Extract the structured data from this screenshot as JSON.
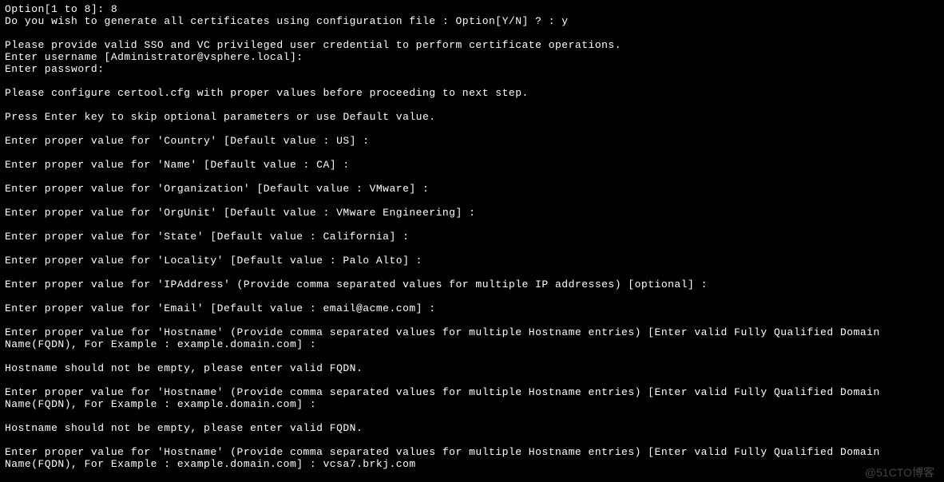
{
  "terminal": {
    "lines": [
      "Option[1 to 8]: 8",
      "Do you wish to generate all certificates using configuration file : Option[Y/N] ? : y",
      "",
      "Please provide valid SSO and VC privileged user credential to perform certificate operations.",
      "Enter username [Administrator@vsphere.local]:",
      "Enter password:",
      "",
      "Please configure certool.cfg with proper values before proceeding to next step.",
      "",
      "Press Enter key to skip optional parameters or use Default value.",
      "",
      "Enter proper value for 'Country' [Default value : US] :",
      "",
      "Enter proper value for 'Name' [Default value : CA] :",
      "",
      "Enter proper value for 'Organization' [Default value : VMware] :",
      "",
      "Enter proper value for 'OrgUnit' [Default value : VMware Engineering] :",
      "",
      "Enter proper value for 'State' [Default value : California] :",
      "",
      "Enter proper value for 'Locality' [Default value : Palo Alto] :",
      "",
      "Enter proper value for 'IPAddress' (Provide comma separated values for multiple IP addresses) [optional] :",
      "",
      "Enter proper value for 'Email' [Default value : email@acme.com] :",
      "",
      "Enter proper value for 'Hostname' (Provide comma separated values for multiple Hostname entries) [Enter valid Fully Qualified Domain Name(FQDN), For Example : example.domain.com] :",
      "",
      "Hostname should not be empty, please enter valid FQDN.",
      "",
      "Enter proper value for 'Hostname' (Provide comma separated values for multiple Hostname entries) [Enter valid Fully Qualified Domain Name(FQDN), For Example : example.domain.com] :",
      "",
      "Hostname should not be empty, please enter valid FQDN.",
      "",
      "Enter proper value for 'Hostname' (Provide comma separated values for multiple Hostname entries) [Enter valid Fully Qualified Domain Name(FQDN), For Example : example.domain.com] : vcsa7.brkj.com"
    ]
  },
  "watermark": "@51CTO博客"
}
